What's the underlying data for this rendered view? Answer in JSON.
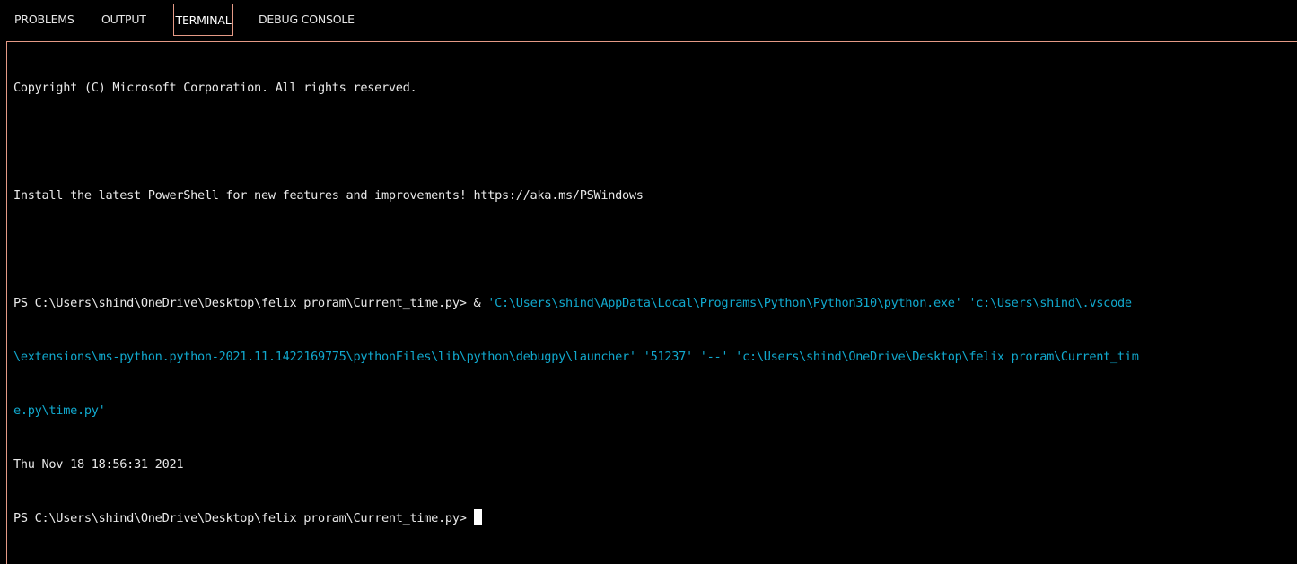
{
  "tabs": [
    {
      "label": "PROBLEMS",
      "active": false
    },
    {
      "label": "OUTPUT",
      "active": false
    },
    {
      "label": "TERMINAL",
      "active": true
    },
    {
      "label": "DEBUG CONSOLE",
      "active": false
    }
  ],
  "terminal": {
    "copyright": "Copyright (C) Microsoft Corporation. All rights reserved.",
    "install_notice": "Install the latest PowerShell for new features and improvements! https://aka.ms/PSWindows",
    "prompt": "PS C:\\Users\\shind\\OneDrive\\Desktop\\felix proram\\Current_time.py>",
    "command_op": " &",
    "command_line_1": " 'C:\\Users\\shind\\AppData\\Local\\Programs\\Python\\Python310\\python.exe' 'c:\\Users\\shind\\.vscode",
    "command_line_2": "\\extensions\\ms-python.python-2021.11.1422169775\\pythonFiles\\lib\\python\\debugpy\\launcher' '51237' '--' 'c:\\Users\\shind\\OneDrive\\Desktop\\felix proram\\Current_tim",
    "command_line_3": "e.py\\time.py'",
    "output": "Thu Nov 18 18:56:31 2021",
    "final_prompt": "PS C:\\Users\\shind\\OneDrive\\Desktop\\felix proram\\Current_time.py>"
  },
  "colors": {
    "background": "#000000",
    "text": "#e8e8e8",
    "command_args": "#11a8cd",
    "accent_border": "#e59a86",
    "cursor": "#ffffff"
  }
}
